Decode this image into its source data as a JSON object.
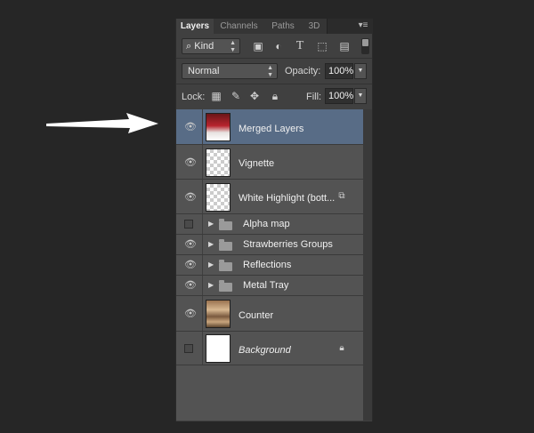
{
  "tabs": [
    {
      "label": "Layers",
      "active": true
    },
    {
      "label": "Channels",
      "active": false
    },
    {
      "label": "Paths",
      "active": false
    },
    {
      "label": "3D",
      "active": false
    }
  ],
  "panel_menu_icon": "panel-menu-icon",
  "filter": {
    "label": "Kind",
    "icons": [
      "pixel-filter-icon",
      "adjustment-filter-icon",
      "type-filter-icon",
      "shape-filter-icon",
      "smart-object-filter-icon"
    ]
  },
  "blend_mode": "Normal",
  "opacity": {
    "label": "Opacity:",
    "value": "100%"
  },
  "lock": {
    "label": "Lock:",
    "icons": [
      "lock-transparent-icon",
      "lock-image-icon",
      "lock-position-icon",
      "lock-all-icon"
    ]
  },
  "fill": {
    "label": "Fill:",
    "value": "100%"
  },
  "layers": [
    {
      "name": "Merged Layers",
      "type": "layer",
      "visible": true,
      "selected": true
    },
    {
      "name": "Vignette",
      "type": "layer",
      "visible": true
    },
    {
      "name": "White Highlight (bott...",
      "type": "smart-object",
      "visible": true
    },
    {
      "name": "Alpha map",
      "type": "group",
      "visible": false
    },
    {
      "name": "Strawberries Groups",
      "type": "group",
      "visible": true
    },
    {
      "name": "Reflections",
      "type": "group",
      "visible": true
    },
    {
      "name": "Metal Tray",
      "type": "group",
      "visible": true
    },
    {
      "name": "Counter",
      "type": "layer",
      "visible": true
    },
    {
      "name": "Background",
      "type": "background",
      "visible": false,
      "locked": true
    }
  ],
  "colors": {
    "selected_row": "#586c86",
    "panel_bg": "#404040",
    "row_bg": "#535353"
  }
}
